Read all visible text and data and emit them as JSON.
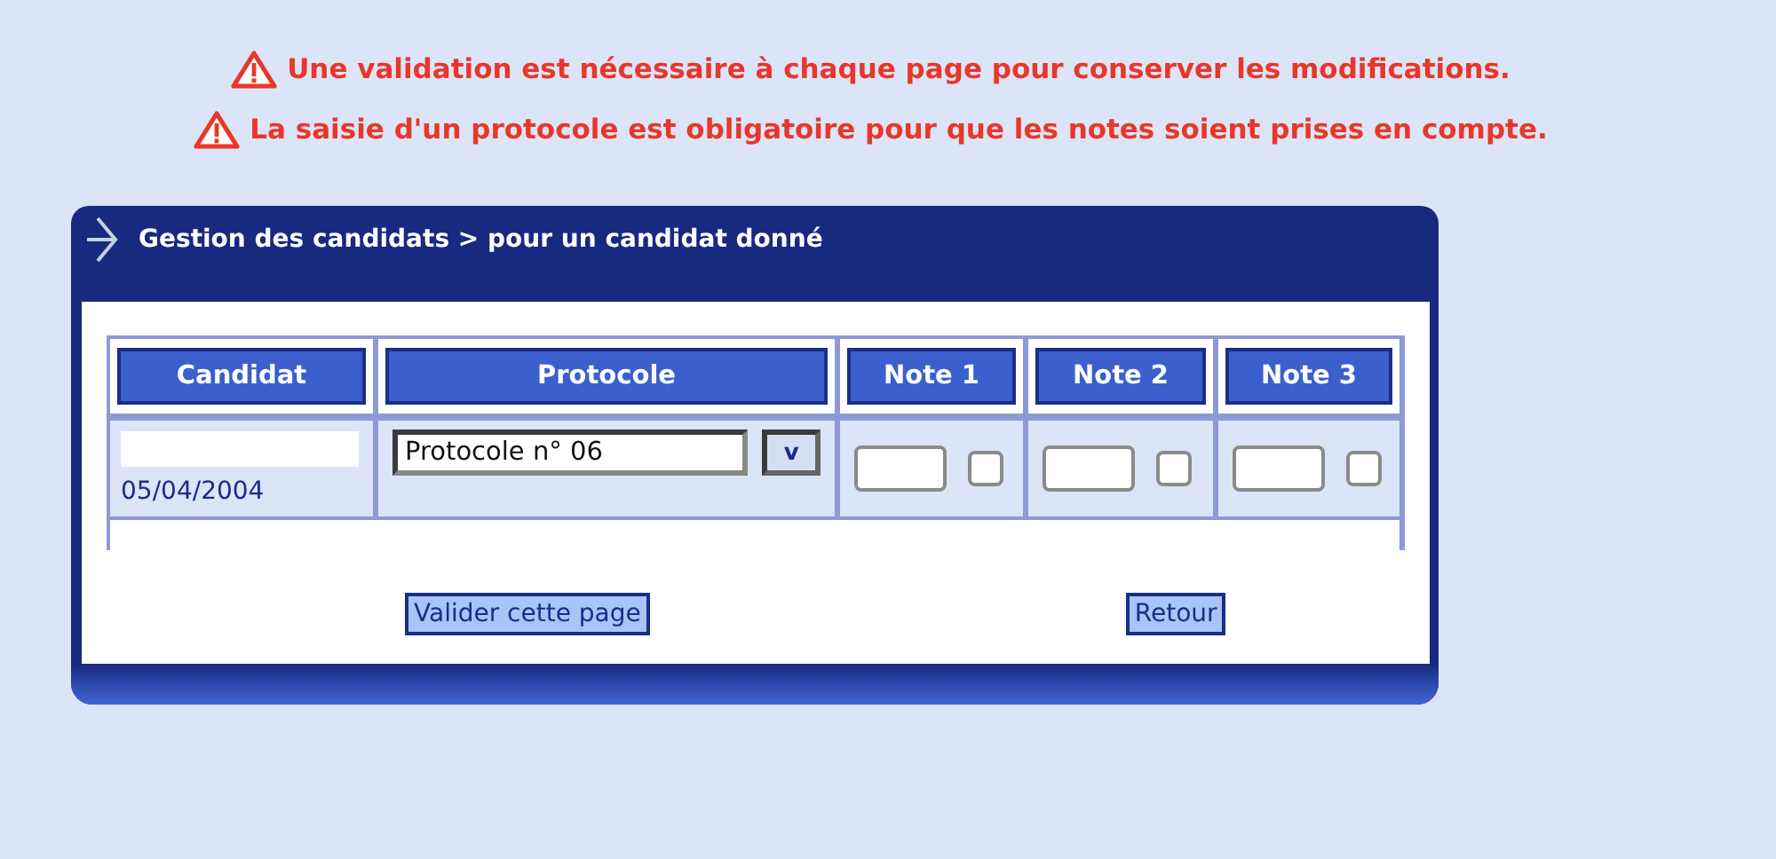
{
  "warnings": [
    "Une validation est nécessaire à chaque page pour conserver les modifications.",
    "La saisie d'un protocole est obligatoire pour que les notes soient prises en compte."
  ],
  "panel": {
    "title": "Gestion des candidats > pour un candidat donné"
  },
  "table": {
    "columns": [
      "Candidat",
      "Protocole",
      "Note 1",
      "Note 2",
      "Note 3"
    ],
    "rows": [
      {
        "date": "05/04/2004",
        "protocole": "Protocole n° 06",
        "picker": "v",
        "notes": [
          {
            "checked": false
          },
          {
            "checked": false
          },
          {
            "checked": false
          }
        ]
      }
    ]
  },
  "buttons": [
    {
      "label": "Valider cette page"
    },
    {
      "label": "Retour"
    }
  ]
}
